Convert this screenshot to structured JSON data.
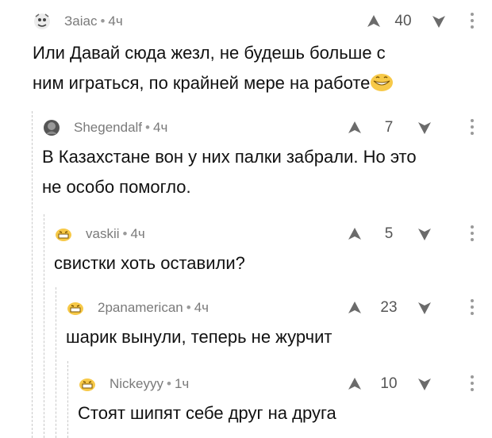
{
  "comments": [
    {
      "user": "Заіас",
      "time": "4ч",
      "votes": "40",
      "text": [
        "Или Давай сюда жезл, не будешь больше с",
        "ним играться, по крайней мере на работе"
      ]
    },
    {
      "user": "Shegendalf",
      "time": "4ч",
      "votes": "7",
      "text": [
        "В Казахстане вон у них палки забрали. Но это",
        "не особо помогло."
      ]
    },
    {
      "user": "vaskii",
      "time": "4ч",
      "votes": "5",
      "text": [
        "свистки хоть оставили?"
      ]
    },
    {
      "user": "2panamerican",
      "time": "4ч",
      "votes": "23",
      "text": [
        "шарик вынули, теперь не журчит"
      ]
    },
    {
      "user": "Nickeyyy",
      "time": "1ч",
      "votes": "10",
      "text": [
        "Стоят шипят себе друг на друга"
      ]
    }
  ],
  "separator": "•",
  "icons": {
    "upvote": "upvote-arrow-icon",
    "downvote": "downvote-arrow-icon",
    "more": "more-vertical-icon",
    "emoji": "grinning-face-icon"
  },
  "colors": {
    "meta": "#7a7a7a",
    "arrow": "#6b6b6b",
    "thread": "#c9c9c9"
  }
}
